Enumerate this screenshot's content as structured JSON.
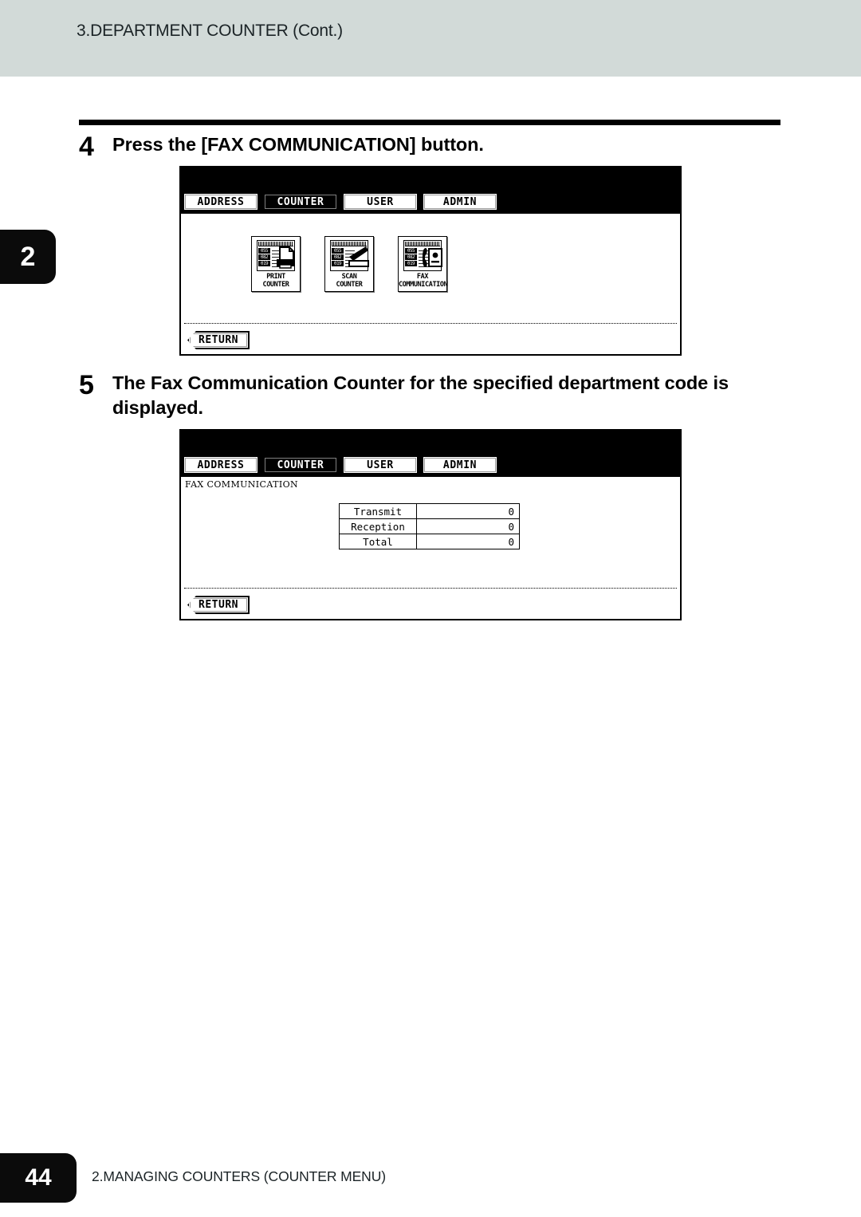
{
  "header": {
    "title": "3.DEPARTMENT COUNTER (Cont.)"
  },
  "chapter_tab": {
    "number": "2"
  },
  "steps": [
    {
      "number": "4",
      "text": "Press the [FAX COMMUNICATION] button."
    },
    {
      "number": "5",
      "text": "The Fax Communication Counter for the specified department code is displayed."
    }
  ],
  "panel1": {
    "tabs": [
      {
        "label": "ADDRESS",
        "selected": false
      },
      {
        "label": "COUNTER",
        "selected": true
      },
      {
        "label": "USER",
        "selected": false
      },
      {
        "label": "ADMIN",
        "selected": false
      }
    ],
    "icon_buttons": [
      {
        "icon": "printer-icon",
        "line1": "PRINT",
        "line2": "COUNTER"
      },
      {
        "icon": "scanner-icon",
        "line1": "SCAN",
        "line2": "COUNTER"
      },
      {
        "icon": "fax-icon",
        "line1": "FAX",
        "line2": "COMMUNICATION"
      }
    ],
    "icon_code_rows": [
      "055",
      "082",
      "019"
    ],
    "return_label": "RETURN"
  },
  "panel2": {
    "tabs": [
      {
        "label": "ADDRESS",
        "selected": false
      },
      {
        "label": "COUNTER",
        "selected": true
      },
      {
        "label": "USER",
        "selected": false
      },
      {
        "label": "ADMIN",
        "selected": false
      }
    ],
    "caption": "FAX COMMUNICATION",
    "table": {
      "rows": [
        {
          "label": "Transmit",
          "value": "0"
        },
        {
          "label": "Reception",
          "value": "0"
        },
        {
          "label": "Total",
          "value": "0"
        }
      ]
    },
    "return_label": "RETURN"
  },
  "footer": {
    "page_number": "44",
    "section": "2.MANAGING COUNTERS (COUNTER MENU)"
  },
  "colors": {
    "header_band": "#d2dad8",
    "tab_black": "#0b0b0b",
    "text": "#1b2326"
  }
}
